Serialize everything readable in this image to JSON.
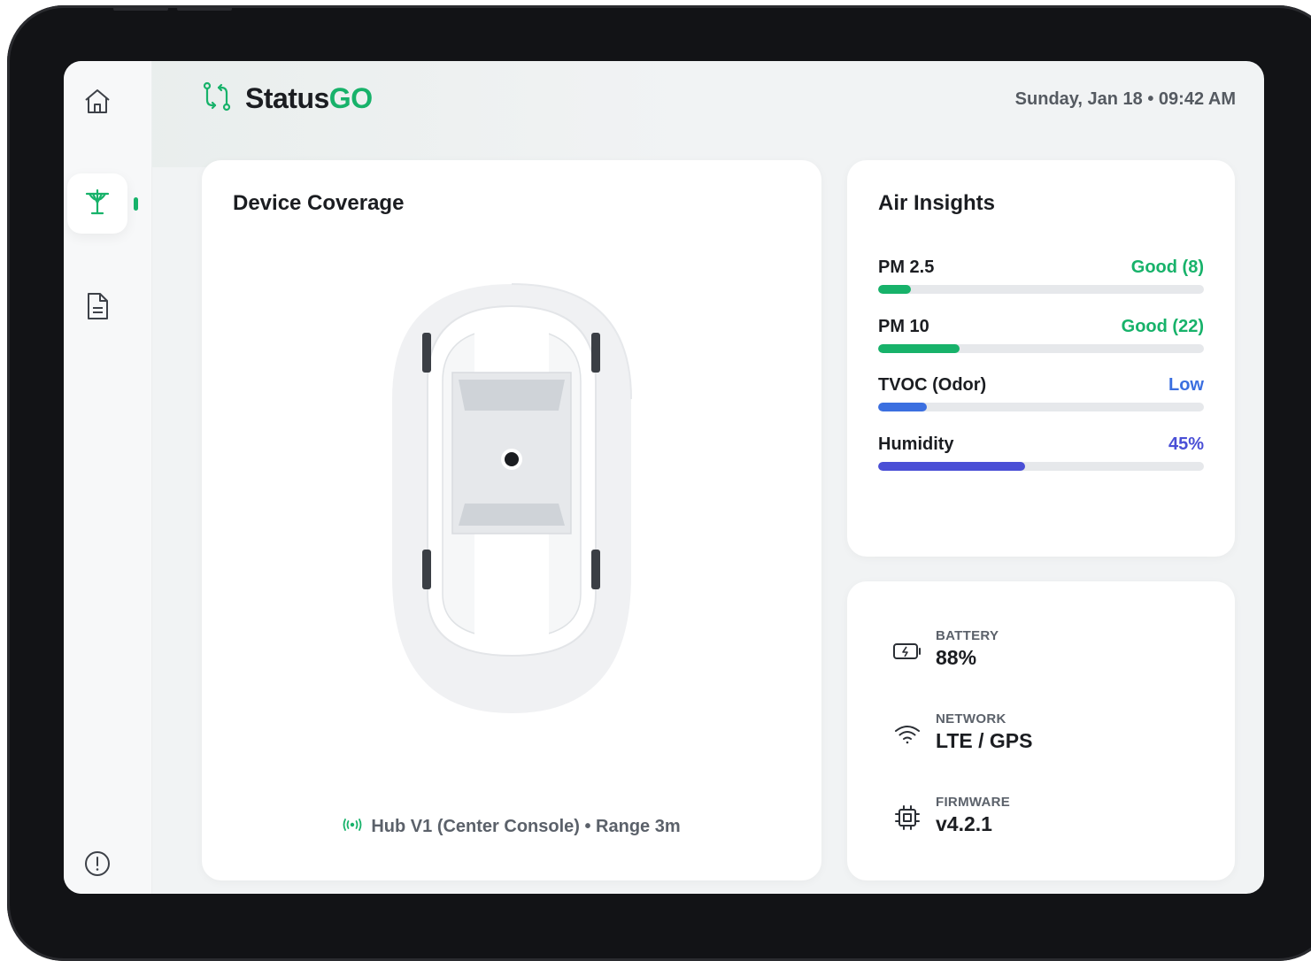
{
  "app": {
    "brand_prefix": "Status",
    "brand_suffix": "GO",
    "datetime": "Sunday, Jan 18 • 09:42 AM"
  },
  "sidebar": {
    "items": [
      {
        "icon": "home-icon"
      },
      {
        "icon": "air-tower-icon",
        "active": true
      },
      {
        "icon": "document-icon"
      }
    ],
    "footer_icon": "info-icon"
  },
  "coverage": {
    "title": "Device Coverage",
    "hub_text": "Hub V1 (Center Console) • Range 3m"
  },
  "air": {
    "title": "Air Insights",
    "metrics": [
      {
        "label": "PM 2.5",
        "value": "Good (8)",
        "fill": 0.1,
        "color": "#17b26a"
      },
      {
        "label": "PM 10",
        "value": "Good (22)",
        "fill": 0.25,
        "color": "#17b26a"
      },
      {
        "label": "TVOC (Odor)",
        "value": "Low",
        "fill": 0.15,
        "color": "#3b6fe0"
      },
      {
        "label": "Humidity",
        "value": "45%",
        "fill": 0.45,
        "color": "#4a4fd6"
      }
    ]
  },
  "status": {
    "battery": {
      "label": "BATTERY",
      "value": "88%",
      "icon": "battery-icon"
    },
    "network": {
      "label": "NETWORK",
      "value": "LTE / GPS",
      "icon": "wifi-icon"
    },
    "firmware": {
      "label": "FIRMWARE",
      "value": "v4.2.1",
      "icon": "chip-icon"
    }
  }
}
